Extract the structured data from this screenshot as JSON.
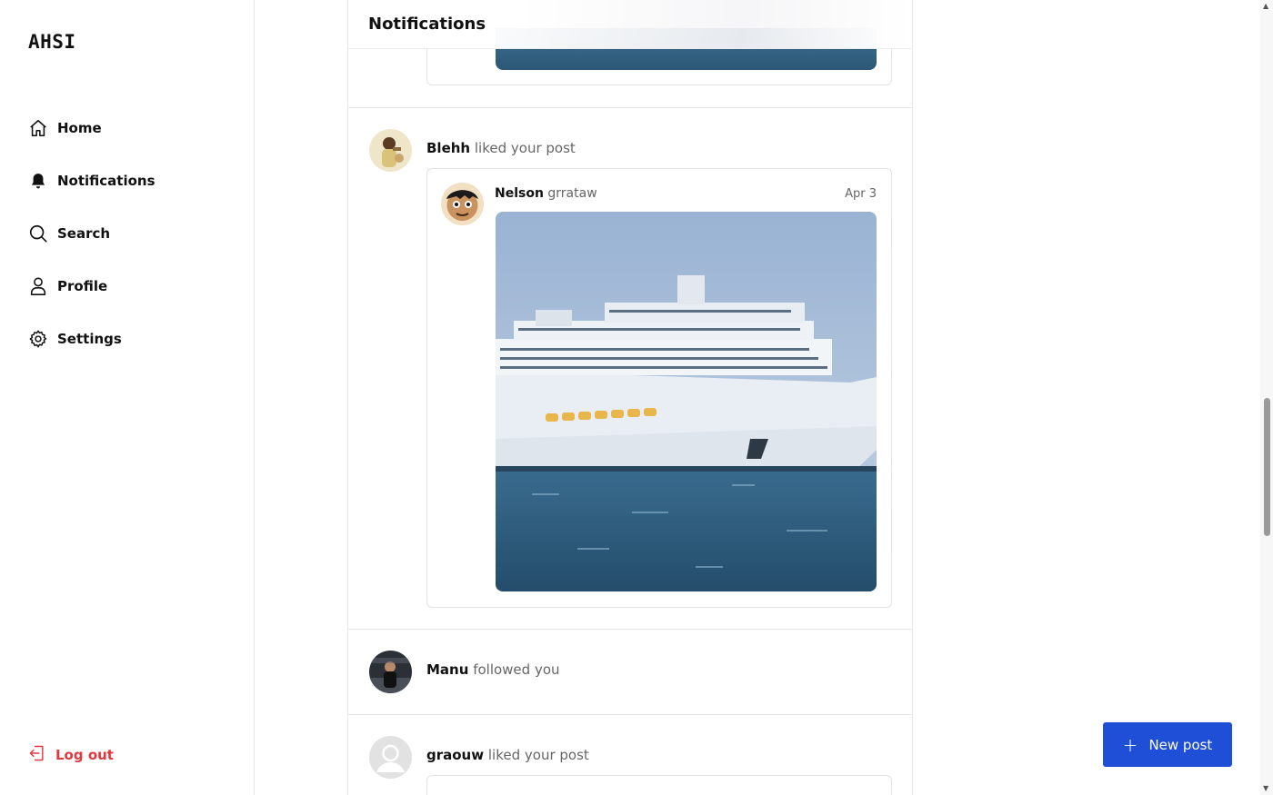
{
  "app": {
    "logo": "AHSI"
  },
  "sidebar": {
    "items": [
      {
        "label": "Home",
        "icon": "home-icon"
      },
      {
        "label": "Notifications",
        "icon": "bell-icon"
      },
      {
        "label": "Search",
        "icon": "search-icon"
      },
      {
        "label": "Profile",
        "icon": "user-icon"
      },
      {
        "label": "Settings",
        "icon": "gear-icon"
      }
    ],
    "logout_label": "Log out"
  },
  "feed": {
    "title": "Notifications",
    "notifications": [
      {
        "user": "Blehh",
        "action": "liked your post",
        "post": {
          "author": "Nelson",
          "handle": "grrataw",
          "date": "Apr 3",
          "image": "cruise-ship-photo"
        }
      },
      {
        "user": "Manu",
        "action": "followed you"
      },
      {
        "user": "graouw",
        "action": "liked your post"
      }
    ]
  },
  "actions": {
    "new_post_label": "New post"
  },
  "colors": {
    "accent": "#1f4fd6",
    "logout": "#e0383e"
  }
}
